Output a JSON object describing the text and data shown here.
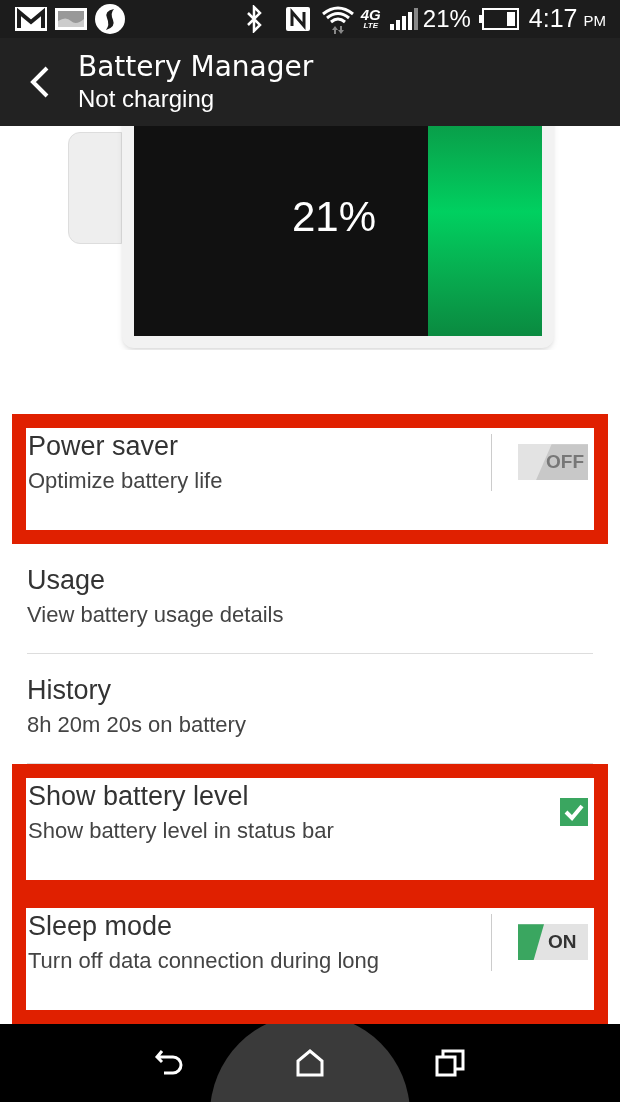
{
  "status_bar": {
    "network_type": "4G",
    "network_sub": "LTE",
    "battery_percent": "21%",
    "time": "4:17",
    "time_suffix": "PM"
  },
  "app_bar": {
    "title": "Battery Manager",
    "subtitle": "Not charging"
  },
  "battery": {
    "percent": "21%",
    "level": 0.28
  },
  "settings": [
    {
      "kind": "switch",
      "title": "Power saver",
      "summary": "Optimize battery life",
      "on": false,
      "toggle_label": "OFF",
      "highlighted": true
    },
    {
      "kind": "link",
      "title": "Usage",
      "summary": "View battery usage details",
      "highlighted": false
    },
    {
      "kind": "link",
      "title": "History",
      "summary": "8h 20m 20s on battery",
      "highlighted": false
    },
    {
      "kind": "checkbox",
      "title": "Show battery level",
      "summary": "Show battery level in status bar",
      "checked": true,
      "highlighted": true
    },
    {
      "kind": "switch",
      "title": "Sleep mode",
      "summary": "Turn off data connection during long",
      "on": true,
      "toggle_label": "ON",
      "highlighted": true
    }
  ]
}
